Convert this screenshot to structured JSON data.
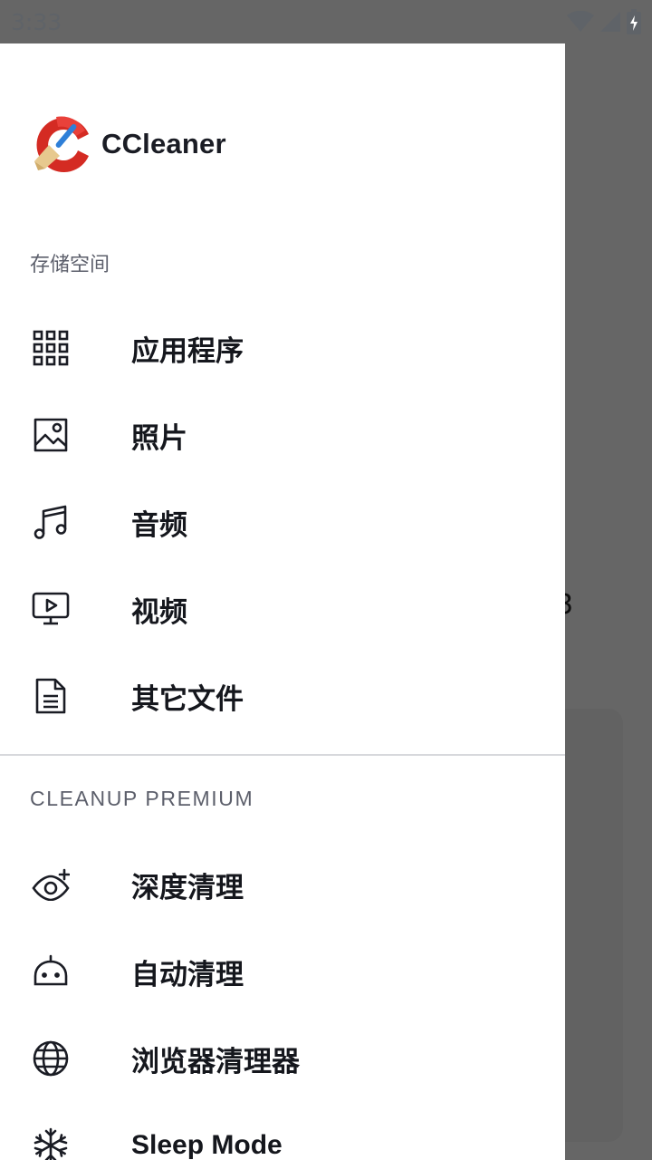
{
  "status_bar": {
    "time": "3:33",
    "icons": [
      "wifi-icon",
      "cell-signal-icon",
      "battery-charging-icon"
    ]
  },
  "backdrop": {
    "partial_text": "3"
  },
  "drawer": {
    "brand": {
      "name": "CCleaner",
      "logo": "ccleaner-logo"
    },
    "storage_section": {
      "title": "存储空间",
      "items": [
        {
          "label": "应用程序",
          "icon": "apps-grid-icon"
        },
        {
          "label": "照片",
          "icon": "photo-icon"
        },
        {
          "label": "音频",
          "icon": "music-note-icon"
        },
        {
          "label": "视频",
          "icon": "video-icon"
        },
        {
          "label": "其它文件",
          "icon": "document-icon"
        }
      ]
    },
    "premium_section": {
      "title": "CLEANUP PREMIUM",
      "items": [
        {
          "label": "深度清理",
          "icon": "eye-plus-icon"
        },
        {
          "label": "自动清理",
          "icon": "robot-icon"
        },
        {
          "label": "浏览器清理器",
          "icon": "globe-icon"
        },
        {
          "label": "Sleep Mode",
          "icon": "snowflake-icon"
        }
      ]
    }
  },
  "colors": {
    "scrim": "#000000",
    "drawer_bg": "#ffffff",
    "text_primary": "#15171d",
    "text_secondary": "#5c5f6b",
    "logo_red": "#d42b23",
    "logo_blue": "#2f7fd8"
  }
}
